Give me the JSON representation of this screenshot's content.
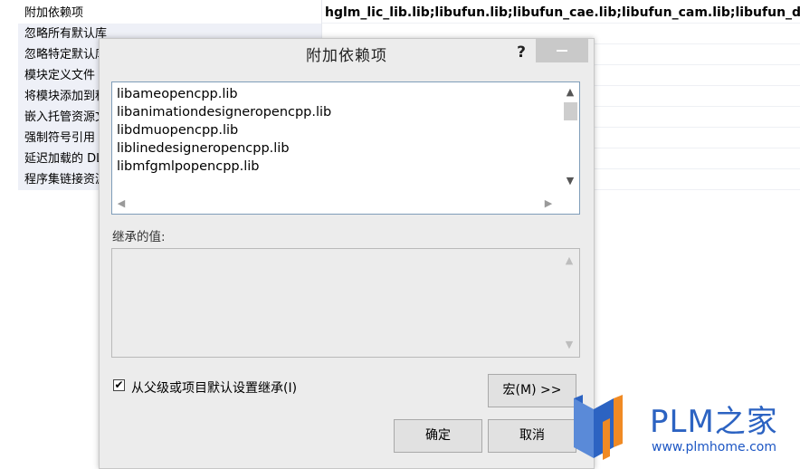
{
  "property_page": {
    "rows": [
      {
        "name": "附加依赖项",
        "value": "hglm_lic_lib.lib;libufun.lib;libufun_cae.lib;libufun_cam.lib;libufun_die.lib"
      },
      {
        "name": "忽略所有默认库",
        "value": ""
      },
      {
        "name": "忽略特定默认库",
        "value": ""
      },
      {
        "name": "模块定义文件",
        "value": ""
      },
      {
        "name": "将模块添加到程序集",
        "value": ""
      },
      {
        "name": "嵌入托管资源文件",
        "value": ""
      },
      {
        "name": "强制符号引用",
        "value": ""
      },
      {
        "name": "延迟加载的 DLL",
        "value": ""
      },
      {
        "name": "程序集链接资源",
        "value": ""
      }
    ]
  },
  "dialog": {
    "title": "附加依赖项",
    "help": "?",
    "entries": [
      "libameopencpp.lib",
      "libanimationdesigneropencpp.lib",
      "libdmuopencpp.lib",
      "liblinedesigneropencpp.lib",
      "libmfgmlpopencpp.lib"
    ],
    "inherited_label": "继承的值:",
    "inherit_checkbox_label": "从父级或项目默认设置继承(I)",
    "inherit_checked": true,
    "macro_button": "宏(M) >>",
    "ok_button": "确定",
    "cancel_button": "取消"
  },
  "watermark": {
    "brand": "PLM之家",
    "url": "www.plmhome.com"
  },
  "colors": {
    "name_cell_bg": "#eef0f7",
    "dialog_bg": "#ececec",
    "close_btn_bg": "#c9c9c9",
    "listbox_border": "#7f9db9",
    "watermark_blue": "#2c63c2",
    "watermark_orange": "#f08a24"
  }
}
